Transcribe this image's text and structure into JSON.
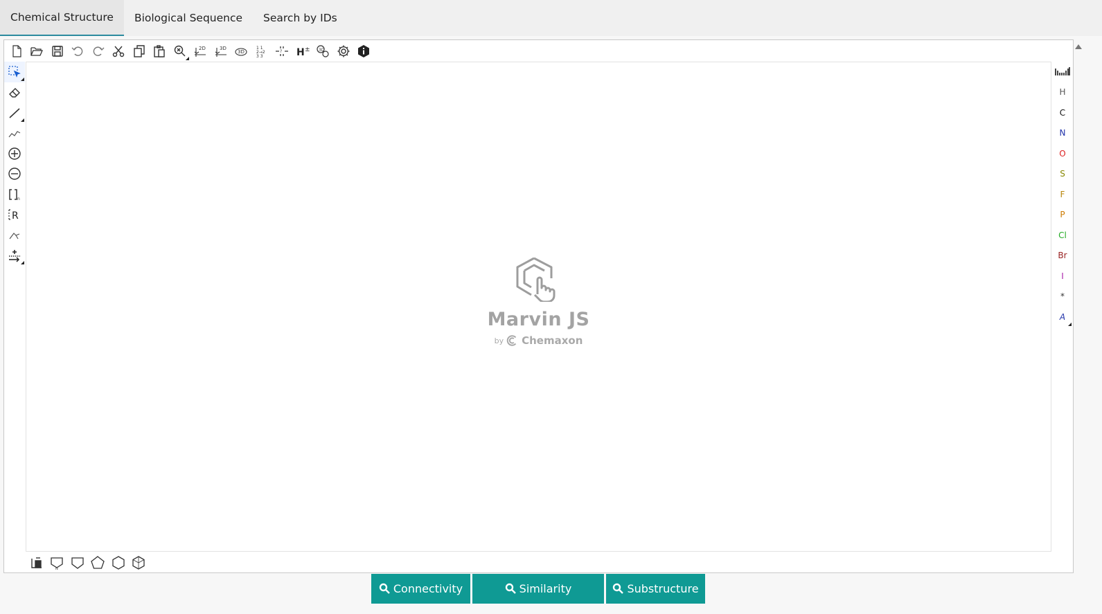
{
  "tabs": [
    {
      "label": "Chemical Structure",
      "active": true
    },
    {
      "label": "Biological Sequence",
      "active": false
    },
    {
      "label": "Search by IDs",
      "active": false
    }
  ],
  "top_toolbar": {
    "icons": [
      "new-document-icon",
      "open-folder-icon",
      "save-icon",
      "undo-icon",
      "redo-icon",
      "cut-icon",
      "copy-icon",
      "paste-icon",
      "zoom-icon",
      "clean-2d-icon",
      "clean-3d-icon",
      "3d-view-icon",
      "number-atoms-icon",
      "aromatize-icon",
      "add-hydrogens-icon",
      "templates-icon",
      "settings-icon",
      "info-icon"
    ]
  },
  "left_toolbar": {
    "icons": [
      "rectangle-select-icon",
      "eraser-icon",
      "single-bond-icon",
      "chain-icon",
      "positive-charge-icon",
      "negative-charge-icon",
      "sgroup-bracket-icon",
      "rgroup-icon",
      "attachment-icon",
      "reaction-arrow-icon"
    ]
  },
  "right_toolbar": {
    "periodic_table_icon": "periodic-table-icon",
    "elements": [
      {
        "symbol": "H",
        "color": "#555555"
      },
      {
        "symbol": "C",
        "color": "#111111"
      },
      {
        "symbol": "N",
        "color": "#2233aa"
      },
      {
        "symbol": "O",
        "color": "#dd2222"
      },
      {
        "symbol": "S",
        "color": "#888800"
      },
      {
        "symbol": "F",
        "color": "#b8860b"
      },
      {
        "symbol": "P",
        "color": "#cc7a00"
      },
      {
        "symbol": "Cl",
        "color": "#22aa22"
      },
      {
        "symbol": "Br",
        "color": "#992222"
      },
      {
        "symbol": "I",
        "color": "#aa22aa"
      },
      {
        "symbol": "*",
        "color": "#333333"
      },
      {
        "symbol": "A",
        "color": "#2233aa"
      }
    ]
  },
  "bottom_toolbar": {
    "icons": [
      "benzene-template-icon",
      "cyclopropane-icon",
      "cyclobutane-icon",
      "cyclopentane-icon",
      "cyclohexane-icon",
      "cycloheptane-icon"
    ]
  },
  "watermark": {
    "title": "Marvin JS",
    "by": "by",
    "brand": "Chemaxon"
  },
  "search_buttons": [
    {
      "label": "Connectivity"
    },
    {
      "label": "Similarity"
    },
    {
      "label": "Substructure"
    }
  ],
  "colors": {
    "accent": "#0f9a94",
    "tab_underline": "#2b8a9e"
  }
}
